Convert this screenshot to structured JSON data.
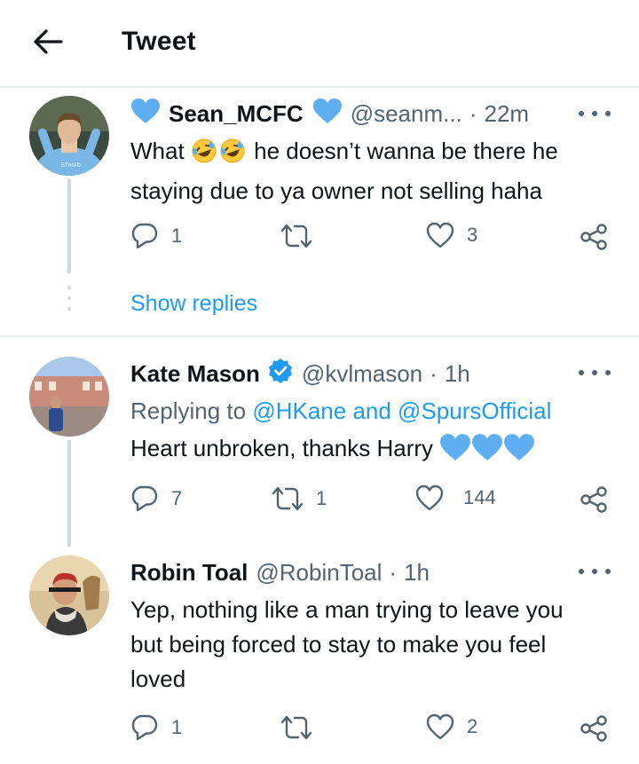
{
  "header": {
    "title": "Tweet"
  },
  "tweets": [
    {
      "name": "Sean_MCFC",
      "handle": "@seanm...",
      "time": "22m",
      "dot": "·",
      "text_before": "What ",
      "text_after": " he doesn’t wanna be there he staying due to ya owner not selling haha",
      "replies": "1",
      "retweets": "",
      "likes": "3",
      "show_replies": "Show replies"
    },
    {
      "name": "Kate Mason",
      "handle": "@kvlmason",
      "time": "1h",
      "dot": "·",
      "replying_prefix": "Replying to ",
      "replying_user1": "@HKane",
      "replying_and": " and ",
      "replying_user2": "@SpursOfficial",
      "text": "Heart unbroken, thanks Harry ",
      "replies": "7",
      "retweets": "1",
      "likes": "144"
    },
    {
      "name": "Robin Toal",
      "handle": "@RobinToal",
      "time": "1h",
      "dot": "·",
      "text": "Yep, nothing like a man trying to leave you but being forced to stay to make you feel loved",
      "replies": "1",
      "retweets": "",
      "likes": "2"
    }
  ],
  "colors": {
    "accent": "#1d9bf0",
    "heart_emoji": "#5daff2",
    "muted": "#536471",
    "divider": "#e6ecf0"
  },
  "icons": [
    "back-arrow-icon",
    "blue-heart-icon",
    "verified-badge-icon",
    "reply-icon",
    "retweet-icon",
    "like-icon",
    "share-icon",
    "more-icon",
    "laughing-emoji-icon"
  ]
}
